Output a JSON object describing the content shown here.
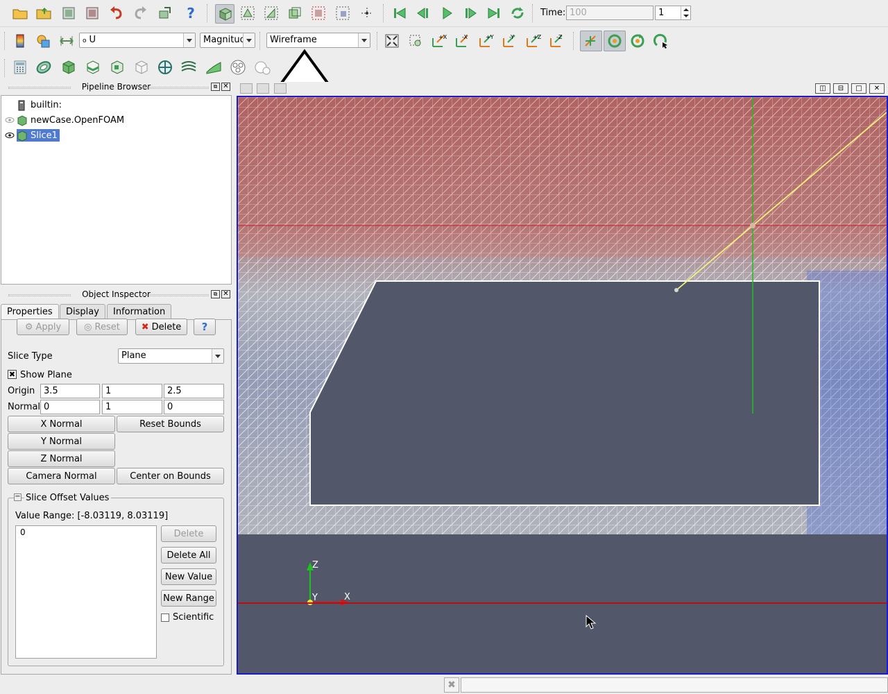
{
  "toolbar_top": {
    "time_label": "Time:",
    "time_value": "100",
    "time_step": "1"
  },
  "toolbar_second": {
    "array_name": "U",
    "component": "Magnituc",
    "representation": "Wireframe"
  },
  "pipeline_browser": {
    "title": "Pipeline Browser",
    "items": [
      {
        "label": "builtin:"
      },
      {
        "label": "newCase.OpenFOAM"
      },
      {
        "label": "Slice1"
      }
    ]
  },
  "object_inspector": {
    "title": "Object Inspector",
    "tabs": [
      "Properties",
      "Display",
      "Information"
    ],
    "apply_label": "Apply",
    "reset_label": "Reset",
    "delete_label": "Delete",
    "help_label": "?",
    "slice_type_label": "Slice Type",
    "slice_type_value": "Plane",
    "show_plane_label": "Show Plane",
    "origin_label": "Origin",
    "origin": [
      "3.5",
      "1",
      "2.5"
    ],
    "normal_label": "Normal",
    "normal": [
      "0",
      "1",
      "0"
    ],
    "x_normal": "X Normal",
    "y_normal": "Y Normal",
    "z_normal": "Z Normal",
    "reset_bounds": "Reset Bounds",
    "camera_normal": "Camera Normal",
    "center_on_bounds": "Center on Bounds",
    "offset_group_label": "Slice Offset Values",
    "value_range": "Value Range: [-8.03119, 8.03119]",
    "offset_values": [
      "0"
    ],
    "offset_delete": "Delete",
    "offset_delete_all": "Delete All",
    "offset_new_value": "New Value",
    "offset_new_range": "New Range",
    "scientific_label": "Scientific"
  },
  "viewport": {
    "background": "#52576a",
    "axis_labels": {
      "z": "Z",
      "y": "Y",
      "x": "X"
    }
  },
  "colors": {
    "mesh_hot": "#e06a5e",
    "mesh_mid": "#ffffff",
    "mesh_cold": "#4a6ad8",
    "frame_border": "#1a1ad0",
    "axis_x": "#d01818",
    "axis_z": "#20c020",
    "widget_line": "#f5f07a"
  },
  "icons": [
    "open-icon",
    "save-state-icon",
    "undo-icon",
    "redo-icon",
    "help-icon",
    "select-icon",
    "first-frame-icon",
    "prev-frame-icon",
    "play-icon",
    "next-frame-icon",
    "last-frame-icon",
    "loop-icon",
    "color-legend-icon",
    "reset-camera-icon",
    "rotate-icon",
    "calculator-icon",
    "contour-icon",
    "clip-icon",
    "slice-icon",
    "threshold-icon",
    "glyph-icon",
    "stream-icon",
    "warp-icon",
    "big-arrow-pointer-icon",
    "mouse-cursor-icon"
  ]
}
